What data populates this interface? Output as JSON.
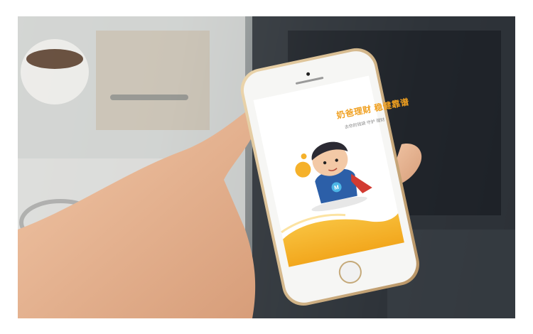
{
  "app_screen": {
    "tagline": "奶爸理财 稳健靠谱",
    "subtitle": "去你的钱袋 守护 理财",
    "mascot_badge_letter": "M"
  },
  "colors": {
    "accent": "#f5b12a",
    "frame_gold": "#d4b483",
    "screen_bg": "#ffffff"
  }
}
